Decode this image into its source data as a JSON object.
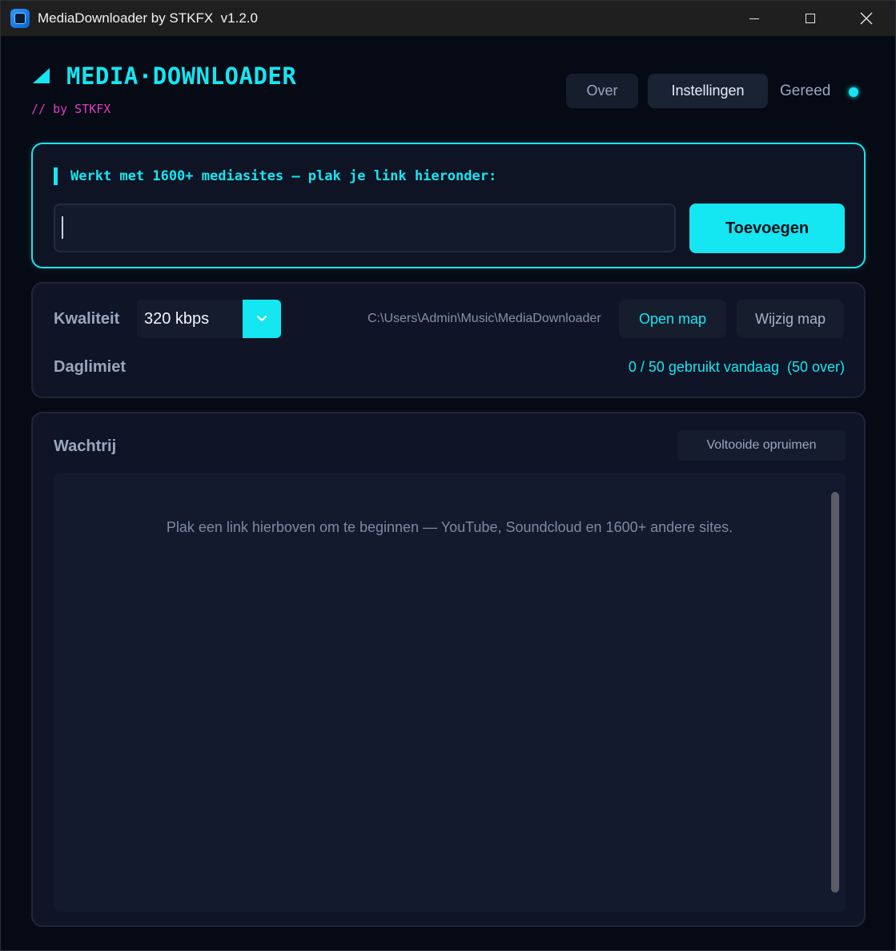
{
  "window": {
    "title": "MediaDownloader by STKFX  v1.2.0",
    "controls": {
      "minimize": "minimize-icon",
      "maximize": "maximize-icon",
      "close": "close-icon"
    }
  },
  "header": {
    "logo_icon": "triangle-icon",
    "title": "MEDIA·DOWNLOADER",
    "subtitle": "// by STKFX",
    "buttons": {
      "about": "Over",
      "settings": "Instellingen"
    },
    "status": {
      "text": "Gereed",
      "dot_color": "#14e6f2"
    }
  },
  "url_panel": {
    "label": "Werkt met 1600+ mediasites — plak je link hieronder:",
    "input_value": "",
    "input_placeholder": "",
    "add_button": "Toevoegen"
  },
  "settings": {
    "quality_label": "Kwaliteit",
    "quality_value": "320 kbps",
    "quality_arrow_icon": "chevron-down-icon",
    "folder_path": "C:\\Users\\Admin\\Music\\MediaDownloader",
    "open_folder": "Open map",
    "change_folder": "Wijzig map",
    "limit_label": "Daglimiet",
    "limit_text": "0 / 50 gebruikt vandaag  (50 over)"
  },
  "queue": {
    "label": "Wachtrij",
    "clear_button": "Voltooide opruimen",
    "empty_message": "Plak een link hierboven om te beginnen — YouTube, Soundcloud en 1600+ andere sites."
  },
  "colors": {
    "accent": "#14e6f2",
    "subtitle": "#e33bc9",
    "background": "#060a14",
    "panel": "#0f1526"
  }
}
